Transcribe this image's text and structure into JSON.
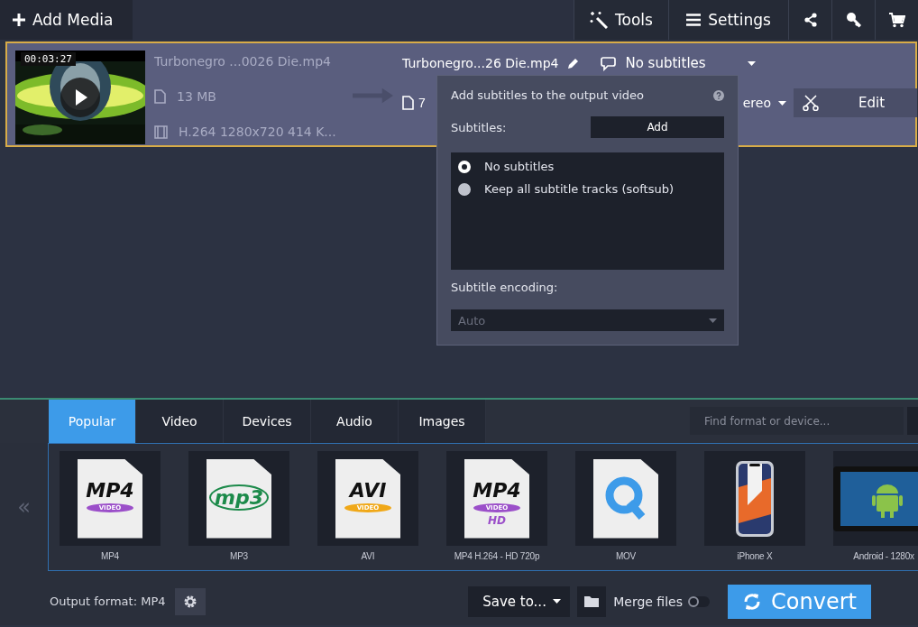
{
  "toolbar": {
    "add_media": "Add Media",
    "buttons": [
      {
        "kind": "tools",
        "label": "Tools"
      },
      {
        "kind": "settings",
        "label": "Settings"
      },
      {
        "kind": "share"
      },
      {
        "kind": "key"
      },
      {
        "kind": "cart"
      }
    ]
  },
  "media": {
    "selected": true,
    "duration": "00:03:27",
    "source": {
      "name": "Turbonegro  ...0026 Die.mp4",
      "size": "13 MB",
      "codec": "H.264 1280x720 414 K..."
    },
    "output": {
      "name": "Turbonegro...26 Die.mp4",
      "subtitles": "No subtitles",
      "size": "7",
      "audio": "ereo"
    },
    "edit": "Edit"
  },
  "subtitle_popup": {
    "title": "Add subtitles to the output video",
    "subtitles_label": "Subtitles:",
    "add": "Add",
    "options": [
      {
        "label": "No subtitles",
        "selected": true
      },
      {
        "label": "Keep all subtitle tracks (softsub)",
        "selected": false
      }
    ],
    "encoding_label": "Subtitle encoding:",
    "encoding": {
      "value": "Auto",
      "disabled": true
    }
  },
  "formats": {
    "tabs": [
      {
        "label": "Popular",
        "selected": true
      },
      {
        "label": "Video",
        "selected": false
      },
      {
        "label": "Devices",
        "selected": false
      },
      {
        "label": "Audio",
        "selected": false
      },
      {
        "label": "Images",
        "selected": false
      }
    ],
    "search": {
      "placeholder": "Find format or device..."
    },
    "prev": "«",
    "items": [
      {
        "kind": "mp4",
        "logo": "MP4",
        "band": "VIDEO",
        "label": "MP4"
      },
      {
        "kind": "mp3",
        "logo": "mp3",
        "label": "MP3"
      },
      {
        "kind": "avi",
        "logo": "AVI",
        "band": "VIDEO",
        "label": "AVI"
      },
      {
        "kind": "mp4",
        "logo": "MP4",
        "band": "VIDEO",
        "badge": "HD",
        "label": "MP4 H.264 - HD 720p"
      },
      {
        "kind": "mov",
        "label": "MOV"
      },
      {
        "kind": "phone",
        "label": "iPhone X"
      },
      {
        "kind": "tablet",
        "label": "Android - 1280x"
      }
    ]
  },
  "footer": {
    "output_format": "Output format: MP4",
    "save_to": "Save to...",
    "merge": {
      "label": "Merge files",
      "on": false
    },
    "convert": "Convert"
  }
}
